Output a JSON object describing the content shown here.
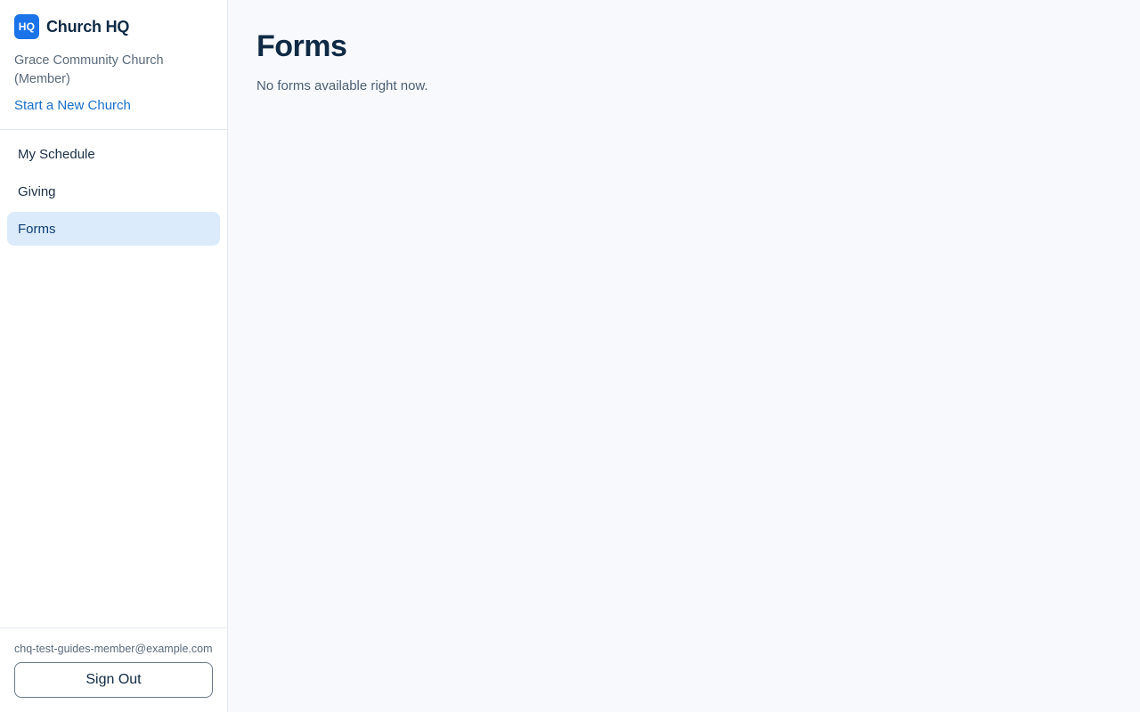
{
  "brand": {
    "logo_text": "HQ",
    "app_name": "Church HQ"
  },
  "church": {
    "name": "Grace Community Church (Member)",
    "start_new_label": "Start a New Church"
  },
  "nav": {
    "items": [
      {
        "label": "My Schedule",
        "active": false
      },
      {
        "label": "Giving",
        "active": false
      },
      {
        "label": "Forms",
        "active": true
      }
    ]
  },
  "footer": {
    "email": "chq-test-guides-member@example.com",
    "sign_out_label": "Sign Out"
  },
  "main": {
    "title": "Forms",
    "empty_message": "No forms available right now."
  },
  "colors": {
    "accent": "#1a73e8",
    "active_nav_bg": "#dcebfb",
    "link": "#1a6fc9"
  }
}
